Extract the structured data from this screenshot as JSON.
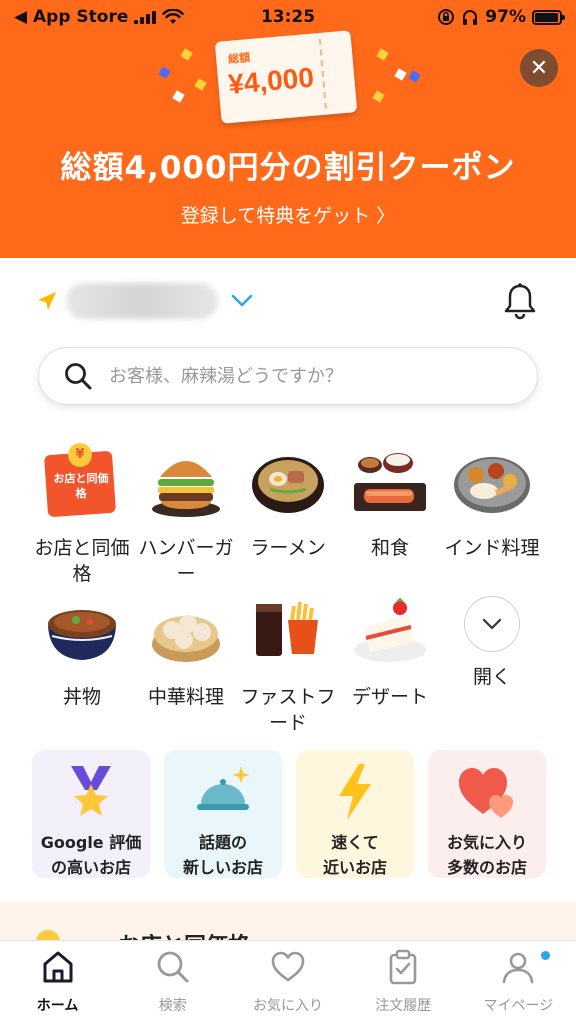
{
  "status_bar": {
    "back_label": "◀ App Store",
    "time": "13:25",
    "battery_percent": "97%",
    "battery_level": 0.97
  },
  "banner": {
    "ticket_tag": "総額",
    "ticket_amount": "¥4,000",
    "title": "総額4,000円分の割引クーポン",
    "link_label": "登録して特典をゲット",
    "link_chevron": "〉",
    "close_glyph": "✕",
    "accent_color": "#ff6a1a"
  },
  "location": {
    "icons": [
      "location-arrow-icon",
      "chevron-down-icon",
      "bell-icon"
    ]
  },
  "search": {
    "placeholder": "お客様、麻辣湯どうですか？"
  },
  "categories": [
    {
      "label": "お店と同価格",
      "image_label": "お店と同価格",
      "icon": "same-price-icon"
    },
    {
      "label": "ハンバーガー",
      "icon": "hamburger-icon"
    },
    {
      "label": "ラーメン",
      "icon": "ramen-icon"
    },
    {
      "label": "和食",
      "icon": "washoku-icon"
    },
    {
      "label": "インド料理",
      "icon": "indian-food-icon"
    },
    {
      "label": "丼物",
      "icon": "donburi-icon"
    },
    {
      "label": "中華料理",
      "icon": "chinese-food-icon"
    },
    {
      "label": "ファストフード",
      "icon": "fast-food-icon"
    },
    {
      "label": "デザート",
      "icon": "dessert-icon"
    },
    {
      "label": "開く",
      "icon": "chevron-down-icon"
    }
  ],
  "feature_cards": [
    {
      "line1": "Google 評価",
      "line2": "の高いお店",
      "bg": "#f4f0fb",
      "icon": "medal-icon"
    },
    {
      "line1": "話題の",
      "line2": "新しいお店",
      "bg": "#e9f7fb",
      "icon": "cloche-icon"
    },
    {
      "line1": "速くて",
      "line2": "近いお店",
      "bg": "#fff7dd",
      "icon": "lightning-icon"
    },
    {
      "line1": "お気に入り",
      "line2": "多数のお店",
      "bg": "#fdeeee",
      "icon": "hearts-icon"
    }
  ],
  "peek_section": {
    "title": "お店と同価格"
  },
  "bottom_nav": [
    {
      "label": "ホーム",
      "icon": "home-icon",
      "active": true
    },
    {
      "label": "検索",
      "icon": "search-icon",
      "active": false
    },
    {
      "label": "お気に入り",
      "icon": "heart-icon",
      "active": false
    },
    {
      "label": "注文履歴",
      "icon": "clipboard-icon",
      "active": false
    },
    {
      "label": "マイページ",
      "icon": "user-icon",
      "active": false,
      "badge_color": "#29a8e8"
    }
  ]
}
